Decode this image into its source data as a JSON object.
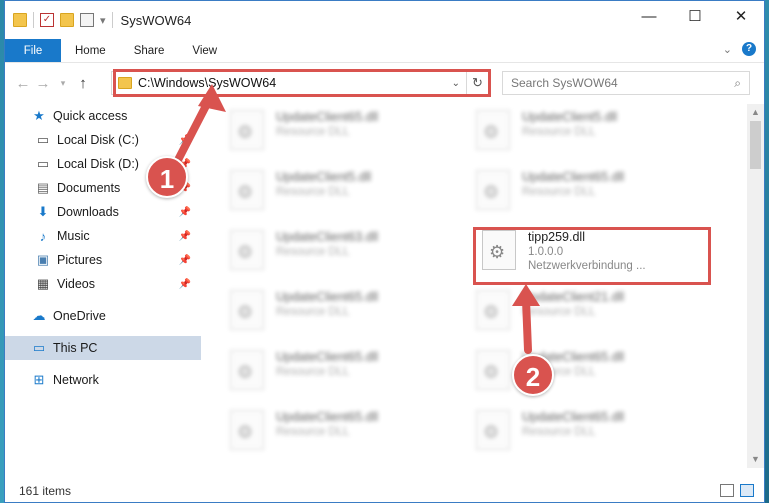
{
  "window": {
    "title": "SysWOW64",
    "caption": {
      "minimize": "—",
      "maximize": "☐",
      "close": "✕"
    }
  },
  "ribbon": {
    "tabs": [
      "File",
      "Home",
      "Share",
      "View"
    ],
    "help": "?",
    "expand": "⌄"
  },
  "address": {
    "path": "C:\\Windows\\SysWOW64",
    "search_placeholder": "Search SysWOW64"
  },
  "nav": {
    "items": [
      {
        "label": "Quick access",
        "icon": "star-icon",
        "pinned": false
      },
      {
        "label": "Local Disk (C:)",
        "icon": "drive-icon",
        "pinned": true
      },
      {
        "label": "Local Disk (D:)",
        "icon": "drive-icon",
        "pinned": true
      },
      {
        "label": "Documents",
        "icon": "documents-icon",
        "pinned": true
      },
      {
        "label": "Downloads",
        "icon": "download-icon",
        "pinned": true
      },
      {
        "label": "Music",
        "icon": "music-icon",
        "pinned": true
      },
      {
        "label": "Pictures",
        "icon": "pictures-icon",
        "pinned": true
      },
      {
        "label": "Videos",
        "icon": "videos-icon",
        "pinned": true
      },
      {
        "label": "OneDrive",
        "icon": "cloud-icon",
        "pinned": false
      },
      {
        "label": "This PC",
        "icon": "computer-icon",
        "pinned": false,
        "selected": true
      },
      {
        "label": "Network",
        "icon": "network-icon",
        "pinned": false
      }
    ]
  },
  "files": [
    {
      "name": "UpdateClient65.dll",
      "sub": "Resource DLL"
    },
    {
      "name": "UpdateClient5.dll",
      "sub": "Resource DLL"
    },
    {
      "name": "UpdateClient5.dll",
      "sub": "Resource DLL"
    },
    {
      "name": "UpdateClient65.dll",
      "sub": "Resource DLL"
    },
    {
      "name": "UpdateClient63.dll",
      "sub": "Resource DLL"
    },
    {
      "name": "tipp259.dll",
      "sub": "1.0.0.0",
      "sub2": "Netzwerkverbindung ...",
      "highlight": true
    },
    {
      "name": "UpdateClient65.dll",
      "sub": "Resource DLL"
    },
    {
      "name": "UpdateClient21.dll",
      "sub": "Resource DLL"
    },
    {
      "name": "UpdateClient65.dll",
      "sub": "Resource DLL"
    },
    {
      "name": "UpdateClient65.dll",
      "sub": "Resource DLL"
    },
    {
      "name": "UpdateClient65.dll",
      "sub": "Resource DLL"
    },
    {
      "name": "UpdateClient65.dll",
      "sub": "Resource DLL"
    }
  ],
  "status": {
    "count": "161 items"
  },
  "callouts": {
    "one": "1",
    "two": "2"
  },
  "colors": {
    "accent": "#1979ca",
    "highlight": "#d9534f",
    "selected_nav": "#ccd8e7"
  }
}
